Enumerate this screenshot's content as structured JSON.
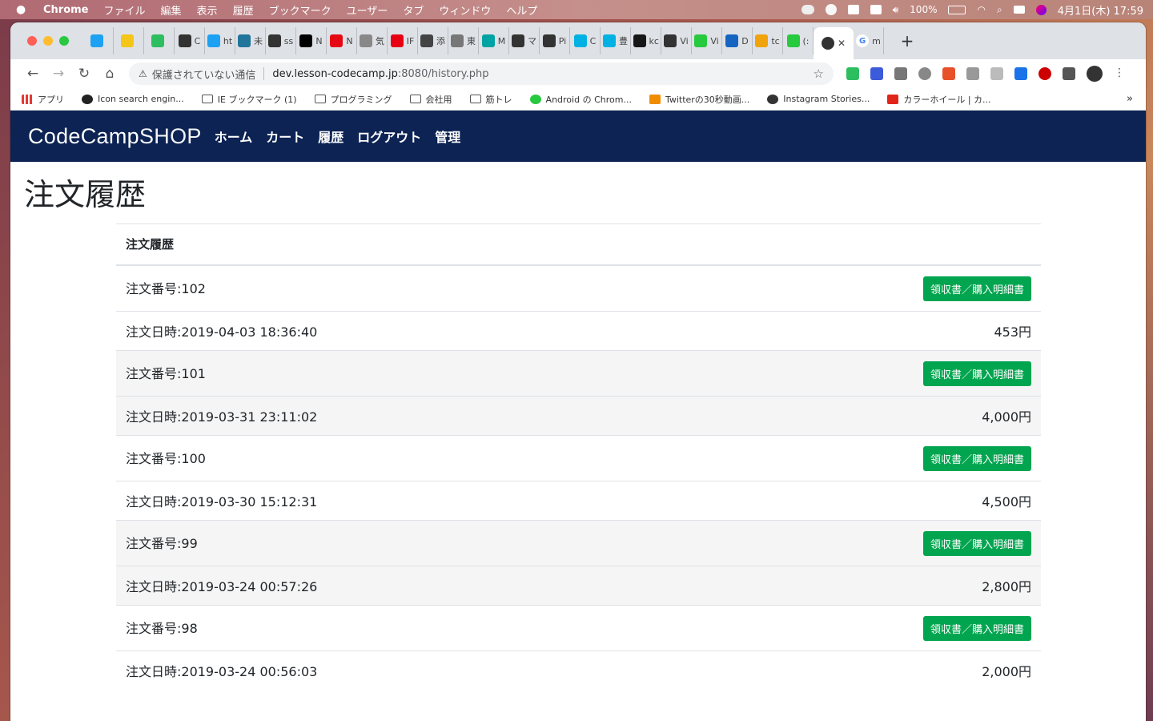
{
  "menubar": {
    "app_name": "Chrome",
    "items": [
      "ファイル",
      "編集",
      "表示",
      "履歴",
      "ブックマーク",
      "ユーザー",
      "タブ",
      "ウィンドウ",
      "ヘルプ"
    ],
    "battery": "100%",
    "datetime": "4月1日(木) 17:59"
  },
  "browser": {
    "tabs": [
      {
        "icon": "twitter-icon",
        "color": "#1da1f2",
        "label": ""
      },
      {
        "icon": "note-icon",
        "color": "#f5c518",
        "label": ""
      },
      {
        "icon": "evernote-icon",
        "color": "#2dbe60",
        "label": ""
      },
      {
        "icon": "globe-icon",
        "color": "#333333",
        "label": "C"
      },
      {
        "icon": "twitter-icon",
        "color": "#1da1f2",
        "label": "ht"
      },
      {
        "icon": "wordpress-icon",
        "color": "#21759b",
        "label": "未"
      },
      {
        "icon": "book-icon",
        "color": "#333333",
        "label": "ss"
      },
      {
        "icon": "notion-icon",
        "color": "#000000",
        "label": "N"
      },
      {
        "icon": "netflix-icon",
        "color": "#e50914",
        "label": "N"
      },
      {
        "icon": "weather-icon",
        "color": "#888888",
        "label": "気"
      },
      {
        "icon": "ipa-icon",
        "color": "#e60012",
        "label": "IF"
      },
      {
        "icon": "t-icon",
        "color": "#444444",
        "label": "添"
      },
      {
        "icon": "flag-icon",
        "color": "#777777",
        "label": "東"
      },
      {
        "icon": "a-icon",
        "color": "#00a3a3",
        "label": "M"
      },
      {
        "icon": "globe-icon",
        "color": "#333333",
        "label": "マ"
      },
      {
        "icon": "globe-icon",
        "color": "#333333",
        "label": "Pi"
      },
      {
        "icon": "c-icon",
        "color": "#00b2e3",
        "label": "C"
      },
      {
        "icon": "c-icon",
        "color": "#00b2e3",
        "label": "豊"
      },
      {
        "icon": "github-icon",
        "color": "#181717",
        "label": "kc"
      },
      {
        "icon": "refresh-icon",
        "color": "#333333",
        "label": "Vi"
      },
      {
        "icon": "circle-icon",
        "color": "#27c93f",
        "label": "Vi"
      },
      {
        "icon": "chart-icon",
        "color": "#1565c0",
        "label": "D"
      },
      {
        "icon": "pma-icon",
        "color": "#f0a30a",
        "label": "tc"
      },
      {
        "icon": "circle-icon",
        "color": "#27c93f",
        "label": "(:"
      }
    ],
    "active_tab_close": "✕",
    "extra_tab_label": "m",
    "new_tab": "+",
    "security_label": "保護されていない通信",
    "url_host": "dev.lesson-codecamp.jp",
    "url_path": ":8080/history.php",
    "bookmarks": [
      {
        "label": "アプリ",
        "icon": "apps-grid-icon"
      },
      {
        "label": "Icon search engin...",
        "icon": "icon-search-icon"
      },
      {
        "label": "IE ブックマーク (1)",
        "icon": "folder-icon"
      },
      {
        "label": "プログラミング",
        "icon": "folder-icon"
      },
      {
        "label": "会社用",
        "icon": "folder-icon"
      },
      {
        "label": "筋トレ",
        "icon": "folder-icon"
      },
      {
        "label": "Android の Chrom...",
        "icon": "android-icon"
      },
      {
        "label": "Twitterの30秒動画...",
        "icon": "twitter-video-icon"
      },
      {
        "label": "Instagram Stories...",
        "icon": "globe-icon"
      },
      {
        "label": "カラーホイール | カ...",
        "icon": "adobe-icon"
      }
    ],
    "bookmarks_more": "»"
  },
  "site": {
    "logo_main": "CodeCamp",
    "logo_sub": "SHOP",
    "nav": [
      "ホーム",
      "カート",
      "履歴",
      "ログアウト",
      "管理"
    ],
    "page_title": "注文履歴",
    "table_header": "注文履歴",
    "receipt_label": "領収書／購入明細書",
    "orders": [
      {
        "number": "注文番号:102",
        "date": "注文日時:2019-04-03 18:36:40",
        "total": "453円"
      },
      {
        "number": "注文番号:101",
        "date": "注文日時:2019-03-31 23:11:02",
        "total": "4,000円"
      },
      {
        "number": "注文番号:100",
        "date": "注文日時:2019-03-30 15:12:31",
        "total": "4,500円"
      },
      {
        "number": "注文番号:99",
        "date": "注文日時:2019-03-24 00:57:26",
        "total": "2,800円"
      },
      {
        "number": "注文番号:98",
        "date": "注文日時:2019-03-24 00:56:03",
        "total": "2,000円"
      }
    ]
  },
  "colors": {
    "nav_bg": "#0c2354",
    "button_green": "#02a54f",
    "close": "#ff5f57",
    "minimize": "#febc2e",
    "zoom": "#28c840"
  }
}
